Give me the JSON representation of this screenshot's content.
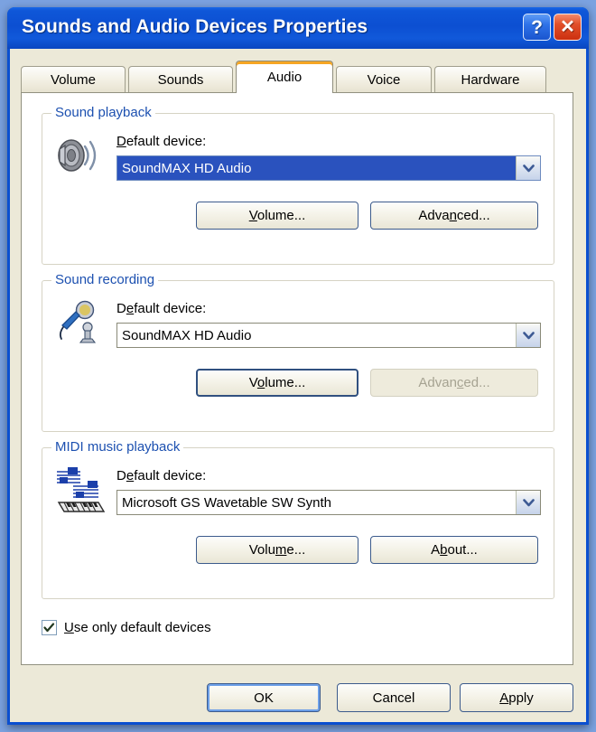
{
  "window": {
    "title": "Sounds and Audio Devices Properties",
    "help_button": "?",
    "close_button": "✕"
  },
  "tabs": [
    {
      "label": "Volume",
      "active": false
    },
    {
      "label": "Sounds",
      "active": false
    },
    {
      "label": "Audio",
      "active": true
    },
    {
      "label": "Voice",
      "active": false
    },
    {
      "label": "Hardware",
      "active": false
    }
  ],
  "sound_playback": {
    "legend": "Sound playback",
    "icon": "speaker-icon",
    "device_label_pre": "D",
    "device_label_accel": "",
    "device_label_post": "efault device:",
    "device_label_full": "Default device:",
    "device_value": "SoundMAX HD Audio",
    "volume_button": "Volume...",
    "volume_accel": "V",
    "advanced_button": "Advanced...",
    "advanced_accel": "n",
    "advanced_disabled": false
  },
  "sound_recording": {
    "legend": "Sound recording",
    "icon": "microphone-icon",
    "device_label_full": "Default device:",
    "device_value": "SoundMAX HD Audio",
    "volume_button": "Volume...",
    "volume_accel": "o",
    "advanced_button": "Advanced...",
    "advanced_accel": "c",
    "advanced_disabled": true
  },
  "midi_playback": {
    "legend": "MIDI music playback",
    "icon": "midi-notes-keyboard-icon",
    "device_label_full": "Default device:",
    "device_value": "Microsoft GS Wavetable SW Synth",
    "volume_button": "Volume...",
    "volume_accel": "m",
    "about_button": "About...",
    "about_accel": "b"
  },
  "options": {
    "use_only_default_devices": "Use only default devices",
    "use_only_default_devices_accel": "U",
    "use_only_default_devices_checked": true
  },
  "footer": {
    "ok": "OK",
    "cancel": "Cancel",
    "apply": "Apply",
    "apply_accel": "A"
  },
  "colors": {
    "titlebar_blue": "#0a4fd0",
    "dialog_face": "#ece9d8",
    "panel_white": "#ffffff",
    "legend_blue": "#1c50b0",
    "selection_blue": "#2a52be",
    "active_tab_accent": "#f5a623",
    "close_red": "#e2502a",
    "disabled_text": "#a6a392"
  }
}
